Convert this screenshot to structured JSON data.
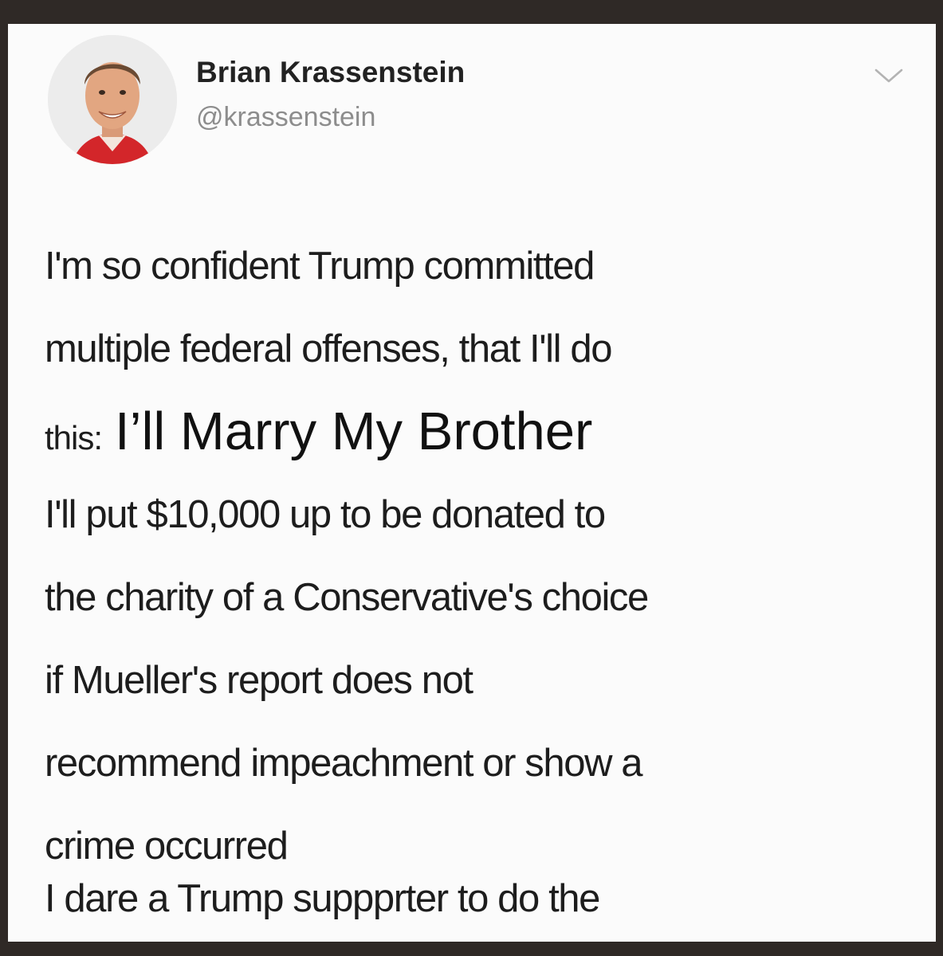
{
  "tweet": {
    "author_name": "Brian Krassenstein",
    "author_handle": "@krassenstein",
    "menu_icon": "chevron-down-icon",
    "lines": [
      "I'm so confident Trump committed",
      "multiple federal offenses, that I'll do"
    ],
    "line3_prefix": "this:",
    "overlay_text": "I’ll Marry My Brother",
    "lines_after": [
      "I'll put $10,000 up to be donated to",
      "the charity of a Conservative's choice",
      "if Mueller's report does not",
      "recommend impeachment or show a",
      "crime occurred"
    ],
    "last_line": "I dare a Trump suppprter to do the"
  },
  "colors": {
    "background": "#2f2926",
    "card": "#fbfbfb",
    "text": "#1d1d1d",
    "handle": "#8d8d8d"
  }
}
